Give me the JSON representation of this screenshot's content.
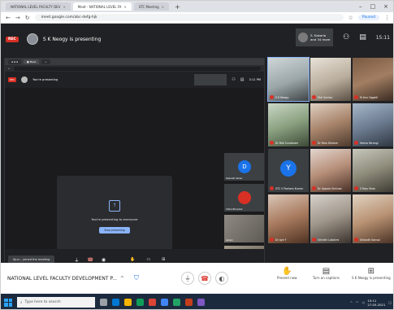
{
  "browser": {
    "tabs": [
      {
        "label": "NATIONAL LEVEL FACULTY DEV",
        "active": false
      },
      {
        "label": "Meet - NATIONAL LEVEL FA",
        "active": true
      },
      {
        "label": "STC Meeting",
        "active": false
      }
    ],
    "url": "meet.google.com/abc-defg-hjk",
    "paused_label": "Paused"
  },
  "meet": {
    "rec_label": "REC",
    "presenting_title": "S K Neogy is presenting",
    "self_name_line1": "S. Kakarla",
    "self_name_line2": "and 34 more",
    "clock": "15:11",
    "inner": {
      "title": "You're presenting",
      "clock": "3:11 PM",
      "present_text": "You're presenting to everyone",
      "stop_label": "Stop presenting",
      "toast": "Ajun... joined the meeting",
      "participants": [
        {
          "initial": "D",
          "name": "Debarati Sarkar",
          "color": "#1a73e8"
        },
        {
          "initial": "",
          "name": "Chitra Bhowmik",
          "color": "#d93025"
        },
        {
          "initial": "",
          "name": "Ashish",
          "color": "#6f6a62"
        },
        {
          "initial": "",
          "name": "Shri Babu",
          "color": "#7e7a70"
        }
      ]
    }
  },
  "grid": [
    {
      "name": "S K Neogy",
      "initial": "",
      "speaking": true
    },
    {
      "name": "Shri Sunkor",
      "initial": "",
      "speaking": false
    },
    {
      "name": "M Anu Oggelli",
      "initial": "",
      "speaking": false
    },
    {
      "name": "Dr Bidi Sundaram",
      "initial": "",
      "speaking": false
    },
    {
      "name": "Dr Ram Kishore",
      "initial": "",
      "speaking": false
    },
    {
      "name": "Veena Yarangi",
      "initial": "",
      "speaking": false
    },
    {
      "name": "STC V Pasham Kumar",
      "initial": "Y",
      "speaking": false
    },
    {
      "name": "Dr Uppala Srinivas",
      "initial": "",
      "speaking": false
    },
    {
      "name": "S Raju Shan",
      "initial": "",
      "speaking": false
    },
    {
      "name": "Dr Aye F",
      "initial": "",
      "speaking": false
    },
    {
      "name": "Srinidhi Lakshmi",
      "initial": "",
      "speaking": false
    },
    {
      "name": "Srikanth Kansal",
      "initial": "",
      "speaking": false
    }
  ],
  "bottom": {
    "meeting_name": "NATIONAL LEVEL FACULTY DEVELOPMENT P...",
    "present_now": "Present now",
    "turn_on_captions": "Turn on captions",
    "stop_presenting": "S K Neogy is presenting"
  },
  "taskbar": {
    "search_placeholder": "Type here to search",
    "time": "15:11",
    "date": "27-05-2021"
  },
  "colors": {
    "meet_bg": "#202124",
    "rec_red": "#d93025",
    "accent_blue": "#1a73e8"
  }
}
